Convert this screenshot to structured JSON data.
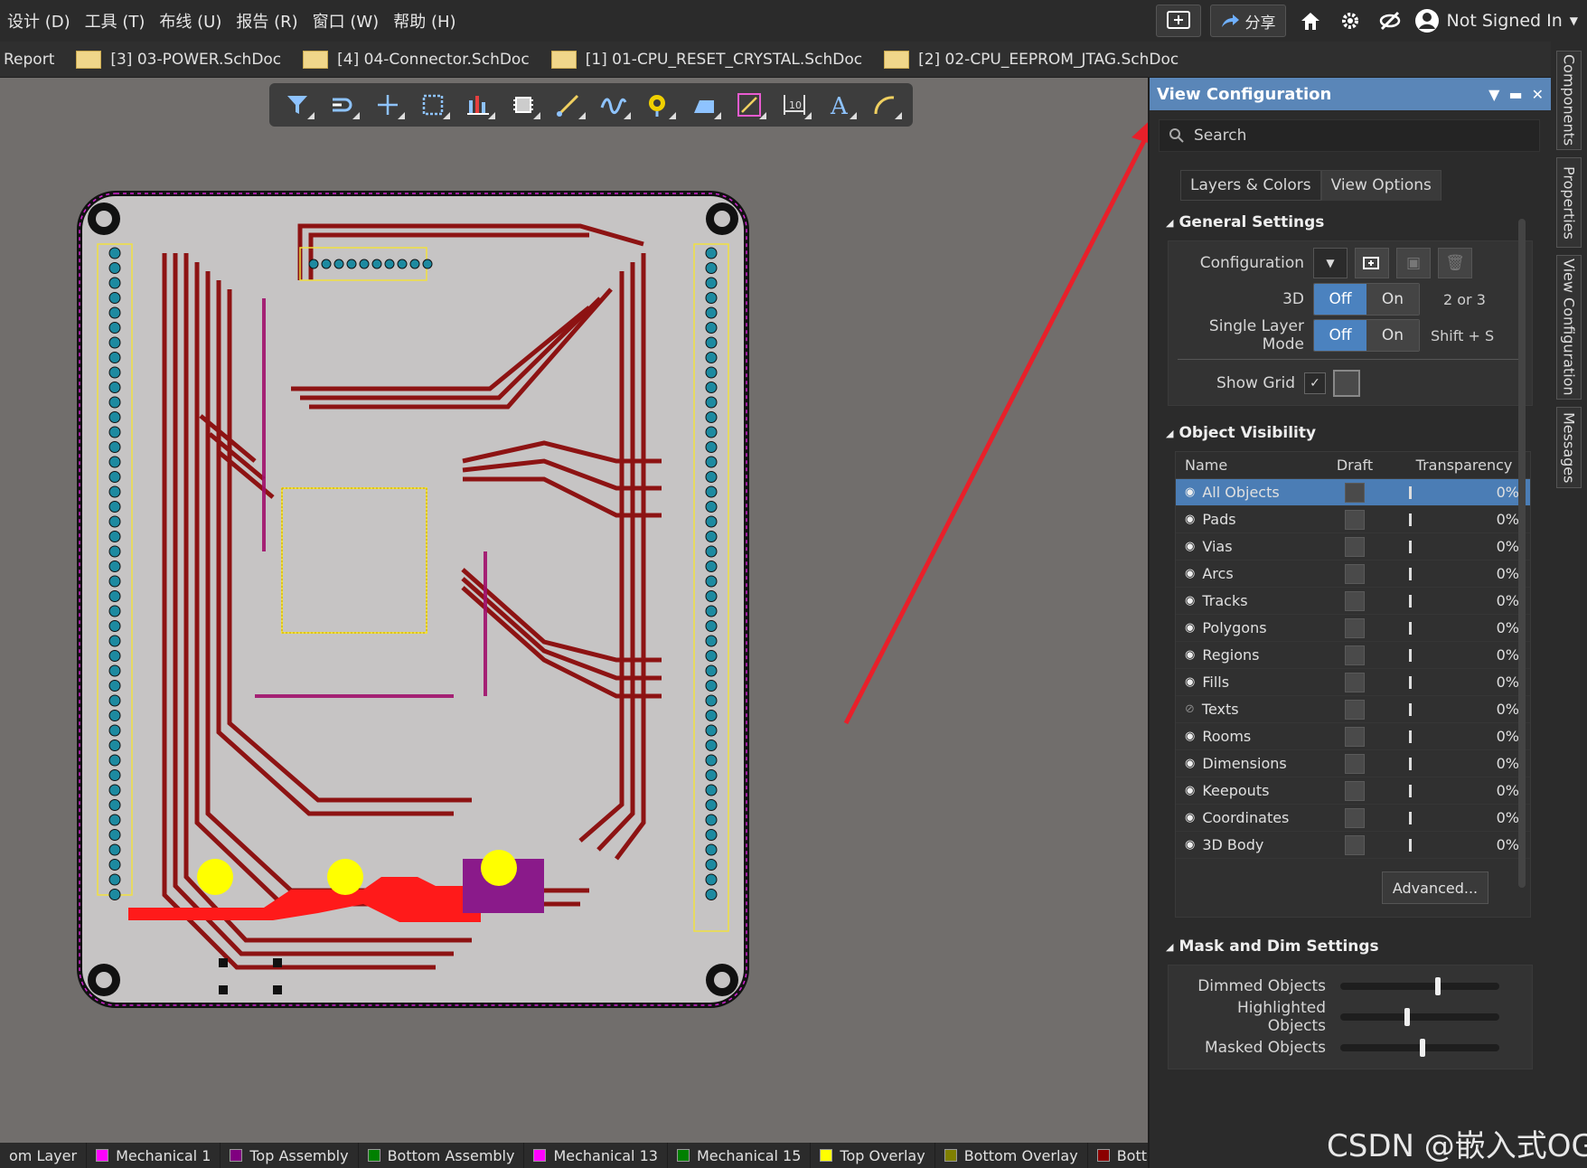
{
  "menu": [
    "设计 (D)",
    "工具 (T)",
    "布线 (U)",
    "报告 (R)",
    "窗口 (W)",
    "帮助 (H)"
  ],
  "topright": {
    "share": "分享",
    "user": "Not Signed In"
  },
  "doc_tabs": [
    "Report",
    "[3] 03-POWER.SchDoc",
    "[4] 04-Connector.SchDoc",
    "[1] 01-CPU_RESET_CRYSTAL.SchDoc",
    "[2] 02-CPU_EEPROM_JTAG.SchDoc"
  ],
  "toolbar_icons": [
    "filter-icon",
    "route-icon",
    "cross-icon",
    "select-rect-icon",
    "bar-chart-icon",
    "component-icon",
    "interactive-route-icon",
    "diff-pair-icon",
    "via-icon",
    "fill-icon",
    "line-icon",
    "dimension-icon",
    "text-icon",
    "arc-icon"
  ],
  "panel": {
    "title": "View Configuration",
    "search_placeholder": "Search",
    "tabs": [
      "Layers & Colors",
      "View Options"
    ],
    "general": {
      "title": "General Settings",
      "configuration_label": "Configuration",
      "three_d_label": "3D",
      "three_d_off": "Off",
      "three_d_on": "On",
      "three_d_hint": "2 or 3",
      "single_layer_label": "Single Layer Mode",
      "single_off": "Off",
      "single_on": "On",
      "single_hint": "Shift + S",
      "show_grid_label": "Show Grid"
    },
    "visibility": {
      "title": "Object Visibility",
      "headers": [
        "Name",
        "Draft",
        "Transparency"
      ],
      "rows": [
        {
          "name": "All Objects",
          "value": "0%"
        },
        {
          "name": "Pads",
          "value": "0%"
        },
        {
          "name": "Vias",
          "value": "0%"
        },
        {
          "name": "Arcs",
          "value": "0%"
        },
        {
          "name": "Tracks",
          "value": "0%"
        },
        {
          "name": "Polygons",
          "value": "0%"
        },
        {
          "name": "Regions",
          "value": "0%"
        },
        {
          "name": "Fills",
          "value": "0%"
        },
        {
          "name": "Texts",
          "value": "0%"
        },
        {
          "name": "Rooms",
          "value": "0%"
        },
        {
          "name": "Dimensions",
          "value": "0%"
        },
        {
          "name": "Keepouts",
          "value": "0%"
        },
        {
          "name": "Coordinates",
          "value": "0%"
        },
        {
          "name": "3D Body",
          "value": "0%"
        }
      ],
      "advanced": "Advanced..."
    },
    "mask": {
      "title": "Mask and Dim Settings",
      "dimmed": "Dimmed Objects",
      "highlighted": "Highlighted Objects",
      "masked": "Masked Objects",
      "dimmed_level": 0.62,
      "highlighted_level": 0.42,
      "masked_level": 0.52
    }
  },
  "side_tabs": [
    "Components",
    "Properties",
    "View Configuration",
    "Messages"
  ],
  "layers": [
    {
      "name": "om Layer",
      "color": "#2b2b2b"
    },
    {
      "name": "Mechanical 1",
      "color": "#ff00ff"
    },
    {
      "name": "Top Assembly",
      "color": "#800080"
    },
    {
      "name": "Bottom Assembly",
      "color": "#008000"
    },
    {
      "name": "Mechanical 13",
      "color": "#ff00ff"
    },
    {
      "name": "Mechanical 15",
      "color": "#008000"
    },
    {
      "name": "Top Overlay",
      "color": "#ffff00"
    },
    {
      "name": "Bottom Overlay",
      "color": "#808000"
    },
    {
      "name": "Bottom",
      "color": "#8b0000"
    }
  ],
  "watermark": "CSDN @嵌入式OG"
}
